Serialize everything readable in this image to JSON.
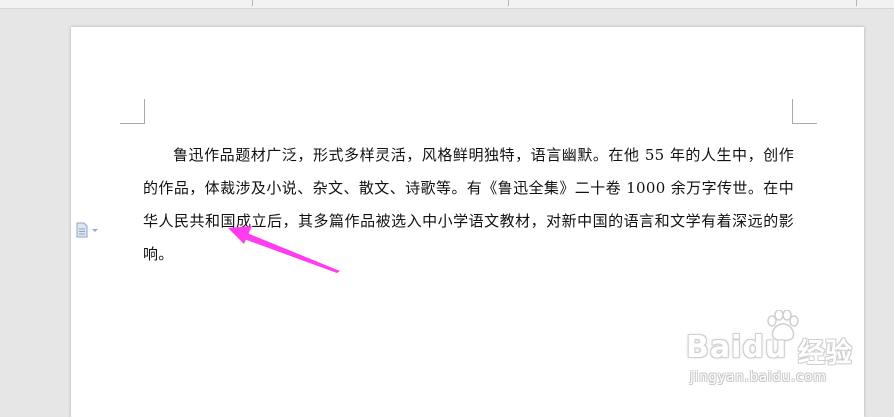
{
  "document": {
    "paragraph": "鲁迅作品题材广泛，形式多样灵活，风格鲜明独特，语言幽默。在他 55 年的人生中，创作的作品，体裁涉及小说、杂文、散文、诗歌等。有《鲁迅全集》二十卷 1000 余万字传世。在中华人民共和国成立后，其多篇作品被选入中小学语文教材，对新中国的语言和文学有着深远的影响。"
  },
  "paragraph_marker": {
    "icon": "document-icon",
    "dropdown_icon": "caret-down-icon"
  },
  "annotation": {
    "color": "#ff3cf0"
  },
  "watermark": {
    "logo_text": "Baidu",
    "product_text": "经验",
    "url": "jingyan.baidu.com"
  },
  "colors": {
    "page_background": "#ffffff",
    "workspace": "#e6e6e6",
    "text": "#111111"
  }
}
